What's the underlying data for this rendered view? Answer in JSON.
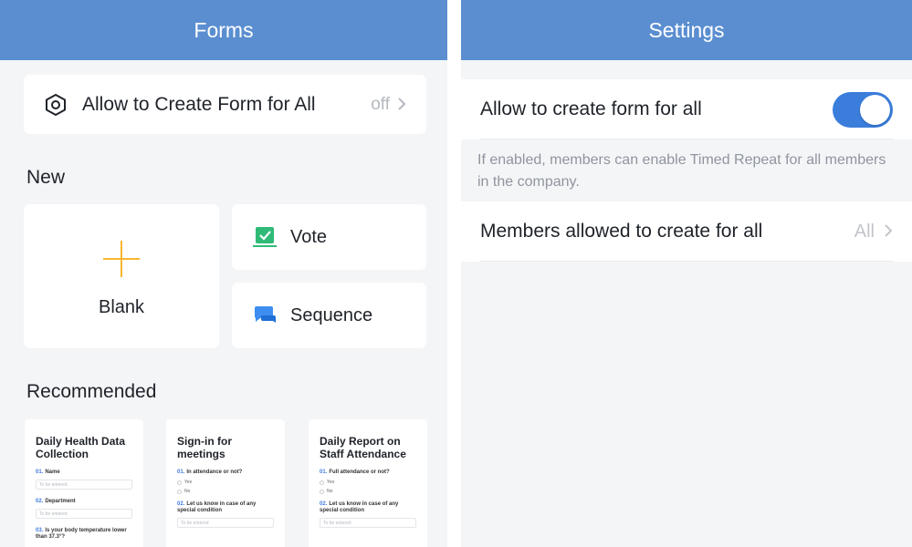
{
  "left": {
    "header": {
      "title": "Forms"
    },
    "allow_row": {
      "label": "Allow to Create Form for All",
      "value": "off",
      "icon": "hexagon-settings-icon"
    },
    "new_section": {
      "title": "New"
    },
    "new_cards": {
      "blank": {
        "label": "Blank",
        "icon": "plus-icon"
      },
      "vote": {
        "label": "Vote",
        "icon": "checkbox-icon"
      },
      "sequence": {
        "label": "Sequence",
        "icon": "chat-bubbles-icon"
      }
    },
    "recommended": {
      "title": "Recommended",
      "templates": [
        {
          "title": "Daily Health Data Collection",
          "q1": "Name",
          "q1_num": "01.",
          "q1_placeholder": "To be entered",
          "q2": "Department",
          "q2_num": "02.",
          "q2_placeholder": "To be entered",
          "q3": "Is your body temperature lower than 37.3°?",
          "q3_num": "03."
        },
        {
          "title": "Sign-in for meetings",
          "q1": "In attendance or not?",
          "q1_num": "01.",
          "opt1": "Yes",
          "opt2": "No",
          "q2": "Let us know in case of any special condition",
          "q2_num": "02.",
          "q2_placeholder": "To be entered"
        },
        {
          "title": "Daily Report on Staff Attendance",
          "q1": "Full attendance or not?",
          "q1_num": "01.",
          "opt1": "Yes",
          "opt2": "No",
          "q2": "Let us know in case of any special condition",
          "q2_num": "02.",
          "q2_placeholder": "To be entered"
        }
      ]
    }
  },
  "right": {
    "header": {
      "title": "Settings"
    },
    "toggle_row": {
      "label": "Allow to create form for all",
      "enabled": true
    },
    "hint": "If enabled, members can enable Timed Repeat for all members in the company.",
    "members_row": {
      "label": "Members allowed to create for all",
      "value": "All"
    }
  },
  "colors": {
    "header_blue": "#5a8ed0",
    "toggle_blue": "#3a7ddb",
    "plus_yellow": "#f7b62d",
    "vote_green": "#2fba77",
    "sequence_blue": "#3d8ef0"
  }
}
